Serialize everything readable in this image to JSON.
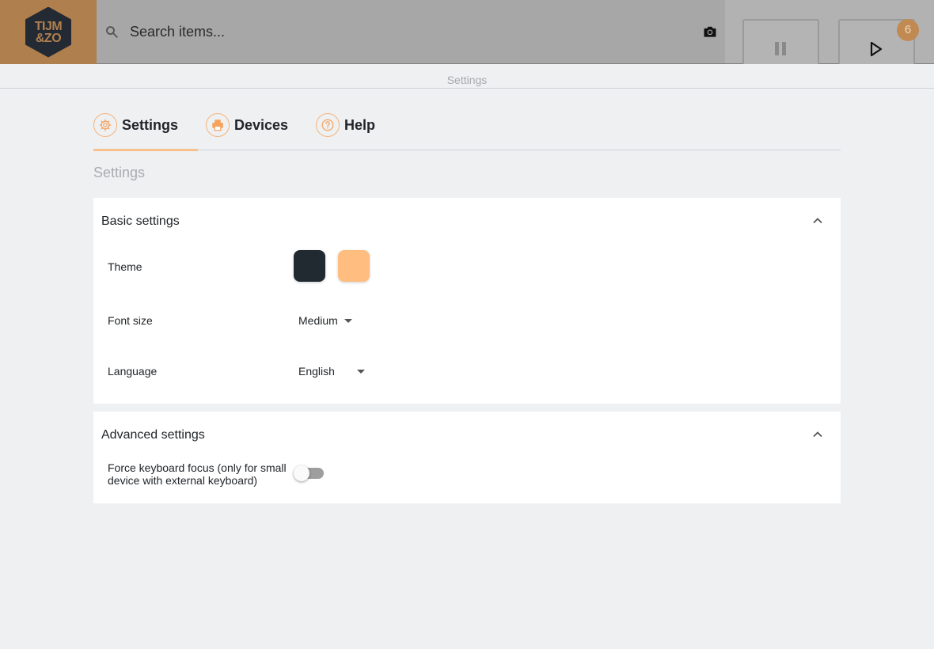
{
  "logo": {
    "line1": "TIJM",
    "line2": "&ZO"
  },
  "search": {
    "placeholder": "Search items..."
  },
  "controls": {
    "badge_count": "6"
  },
  "breadcrumb": {
    "label": "Settings"
  },
  "tabs": [
    {
      "label": "Settings",
      "icon": "gear-icon",
      "active": true
    },
    {
      "label": "Devices",
      "icon": "printer-icon",
      "active": false
    },
    {
      "label": "Help",
      "icon": "help-icon",
      "active": false
    }
  ],
  "section_title": "Settings",
  "basic": {
    "header": "Basic settings",
    "theme_label": "Theme",
    "theme_colors": [
      "#222a31",
      "#ffbe80"
    ],
    "font_size_label": "Font size",
    "font_size_value": "Medium",
    "language_label": "Language",
    "language_value": "English"
  },
  "advanced": {
    "header": "Advanced settings",
    "keyboard_focus_line1": "Force keyboard focus (only for small",
    "keyboard_focus_line2": "device with external keyboard)",
    "keyboard_focus_enabled": false
  },
  "colors": {
    "accent": "#f9c08d",
    "brand": "#b07f4e"
  }
}
